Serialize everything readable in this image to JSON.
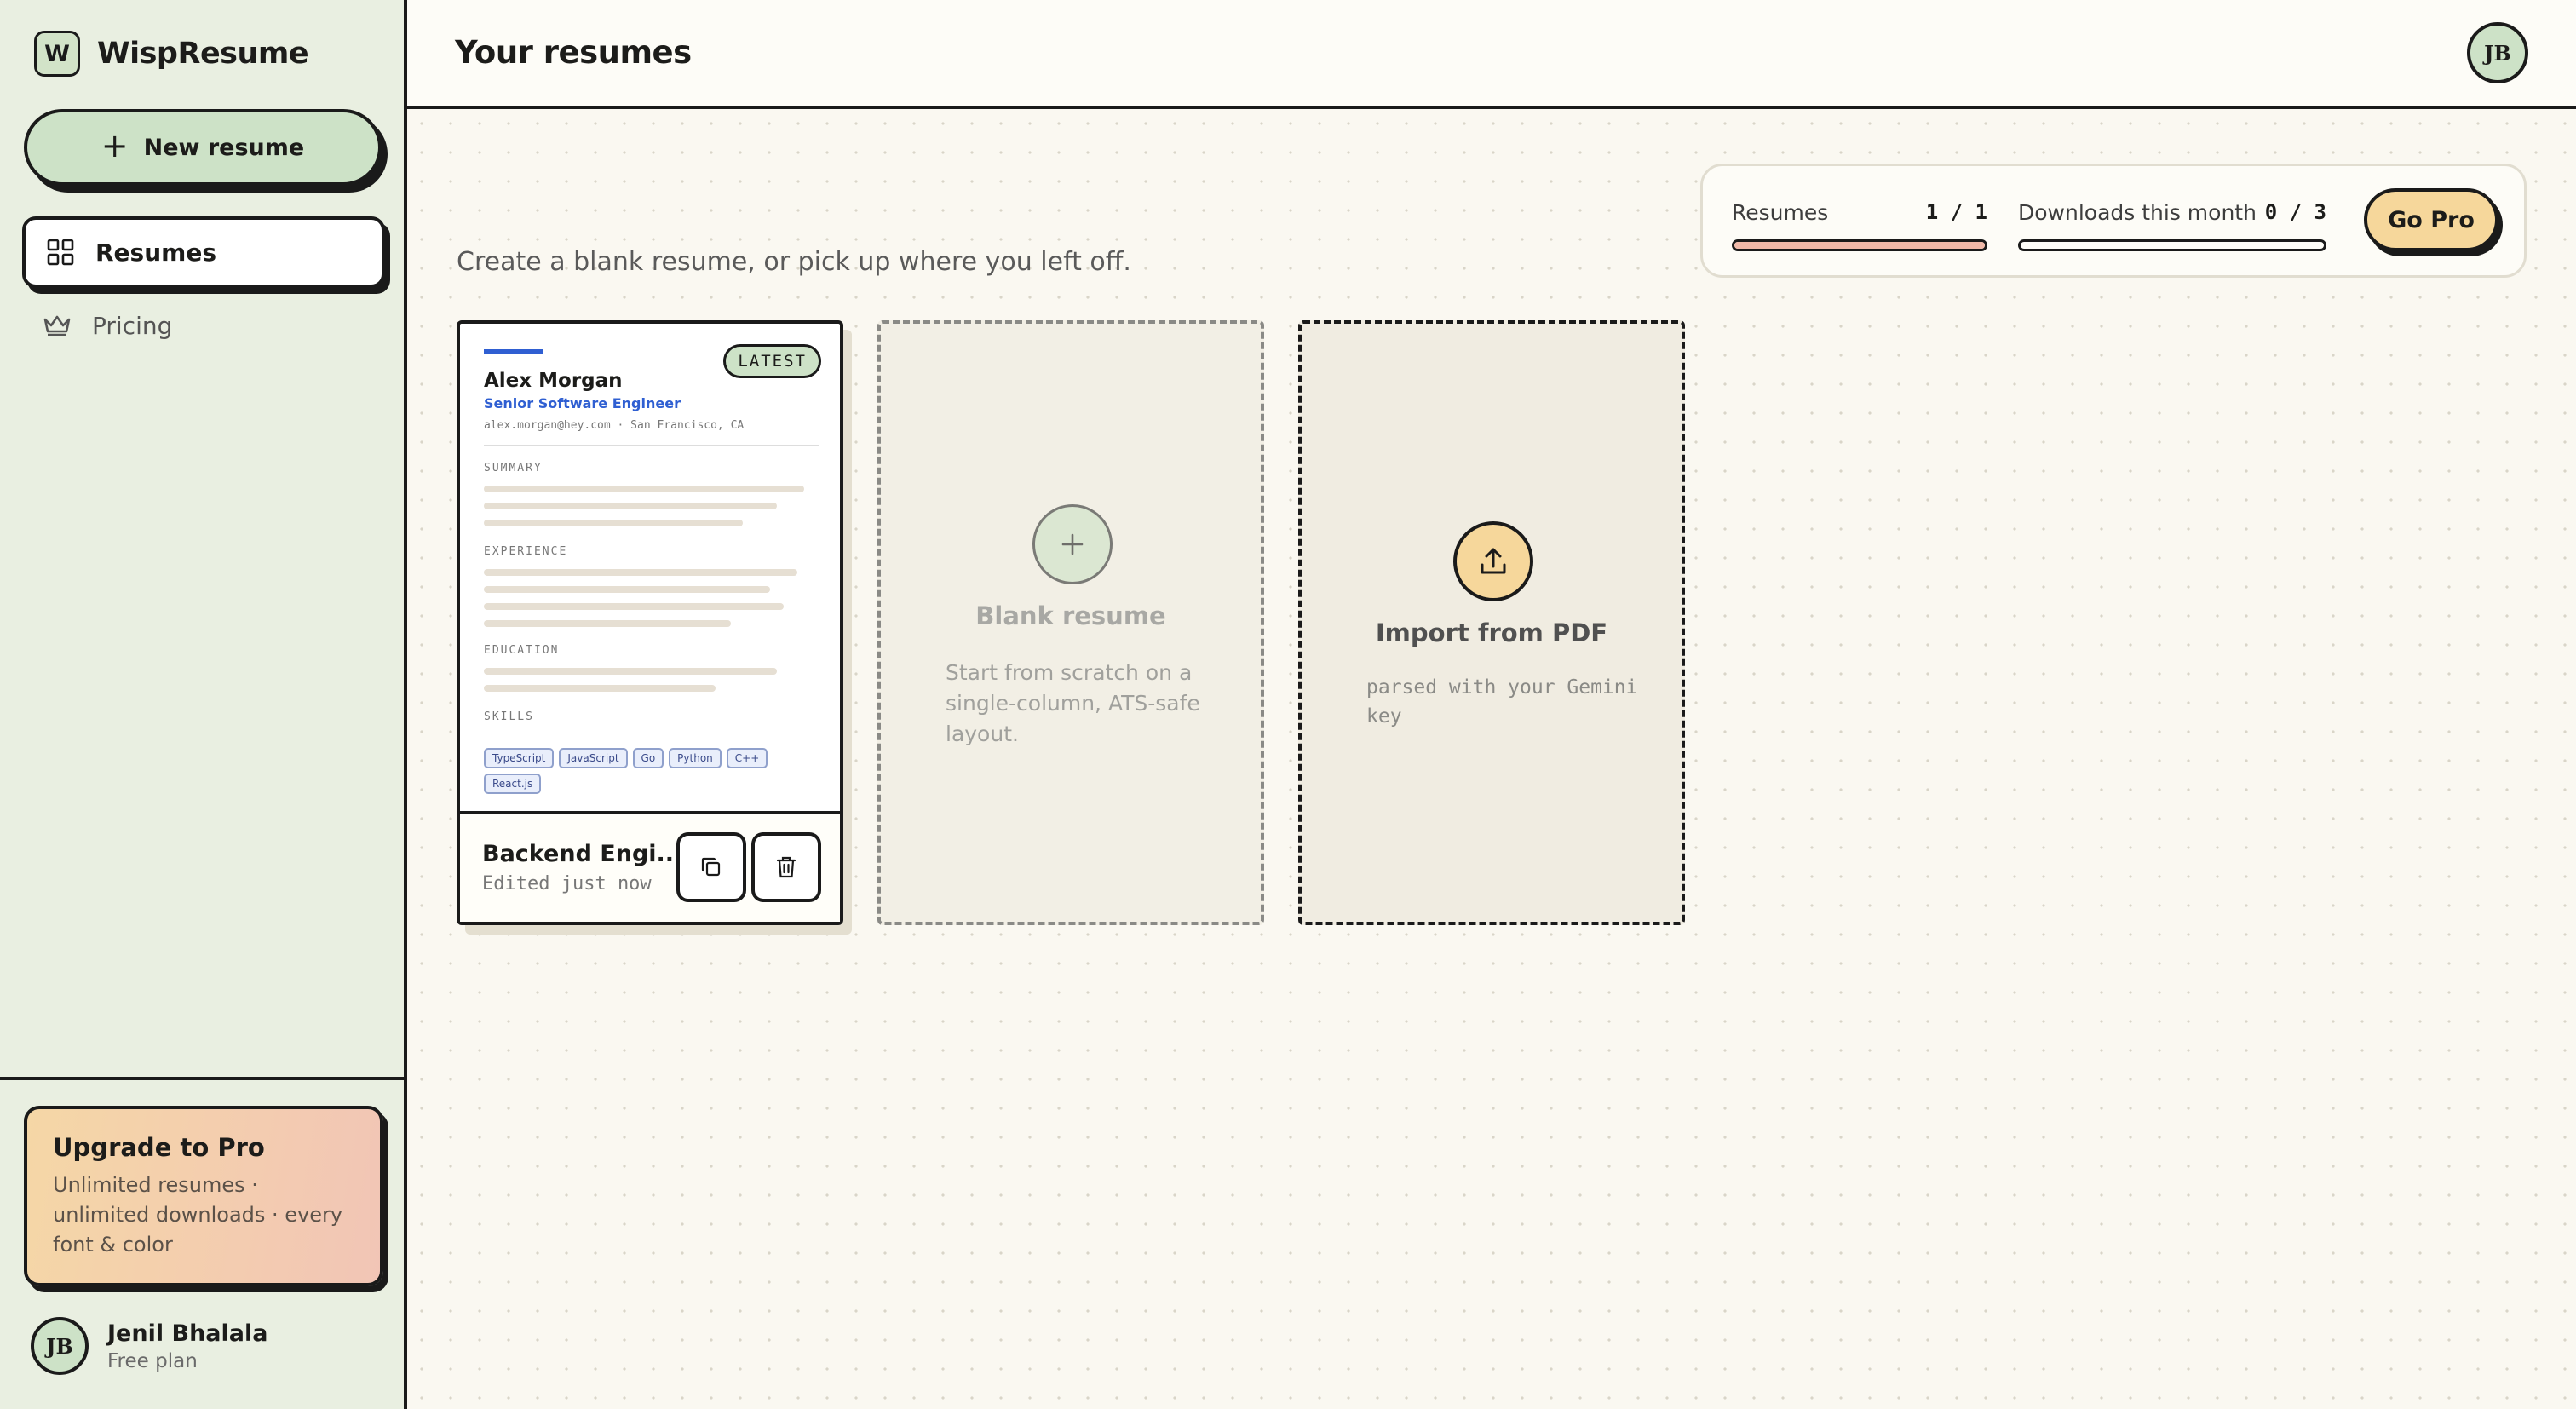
{
  "app": {
    "brand_initial": "W",
    "brand_name": "WispResume"
  },
  "sidebar": {
    "new_resume_label": "New resume",
    "items": [
      {
        "label": "Resumes",
        "icon": "grid-icon",
        "active": true
      },
      {
        "label": "Pricing",
        "icon": "crown-icon",
        "active": false
      }
    ],
    "upgrade": {
      "title": "Upgrade to Pro",
      "description": "Unlimited resumes · unlimited downloads · every font & color"
    },
    "user": {
      "initials": "JB",
      "name": "Jenil Bhalala",
      "plan": "Free plan"
    }
  },
  "header": {
    "title": "Your resumes",
    "avatar_initials": "JB"
  },
  "usage": {
    "resumes_label": "Resumes",
    "resumes_count": "1 / 1",
    "resumes_fraction": 1.0,
    "downloads_label": "Downloads this month",
    "downloads_count": "0 / 3",
    "downloads_fraction": 0.0,
    "go_pro_label": "Go Pro"
  },
  "main": {
    "subtitle": "Create a blank resume, or pick up where you left off."
  },
  "resume_card": {
    "badge": "LATEST",
    "preview": {
      "name": "Alex Morgan",
      "role": "Senior Software Engineer",
      "contact": "alex.morgan@hey.com · San Francisco, CA",
      "sections": [
        "SUMMARY",
        "EXPERIENCE",
        "EDUCATION",
        "SKILLS"
      ],
      "skills": [
        "TypeScript",
        "JavaScript",
        "Go",
        "Python",
        "C++",
        "React.js"
      ]
    },
    "title": "Backend Engi...",
    "edited": "Edited just now"
  },
  "blank_tile": {
    "title": "Blank resume",
    "description": "Start from scratch on a single-column, ATS-safe layout."
  },
  "import_tile": {
    "title": "Import from PDF",
    "description": "parsed with your Gemini key"
  },
  "colors": {
    "sidebar_bg": "#e9efe1",
    "accent_green": "#cde2c7",
    "accent_yellow": "#f6d79b",
    "resume_blue": "#2f5fd2"
  }
}
